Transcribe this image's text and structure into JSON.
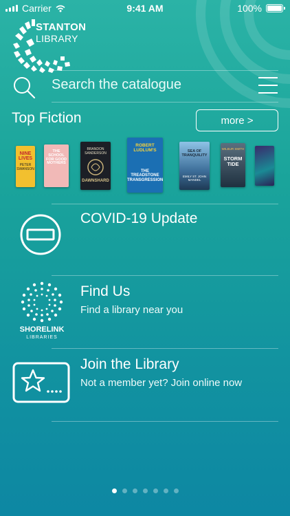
{
  "status_bar": {
    "carrier": "Carrier",
    "time": "9:41 AM",
    "battery": "100%"
  },
  "logo": {
    "line1": "STANTON",
    "line2": "LIBRARY"
  },
  "search": {
    "placeholder": "Search the catalogue"
  },
  "top_fiction": {
    "title": "Top Fiction",
    "more_label": "more >",
    "books": [
      {
        "title": "NINE LIVES",
        "author": "PETER SWANSON"
      },
      {
        "title": "THE SCHOOL FOR GOOD MOTHERS",
        "author": ""
      },
      {
        "title": "DAWNSHARD",
        "author": "BRANDON SANDERSON"
      },
      {
        "title": "THE TREADSTONE TRANSGRESSION",
        "author": "ROBERT LUDLUM'S"
      },
      {
        "title": "SEA OF TRANQUILITY",
        "author": "EMILY ST. JOHN MANDEL"
      },
      {
        "title": "STORM TIDE",
        "author": "WILBUR SMITH"
      },
      {
        "title": "",
        "author": ""
      }
    ]
  },
  "cards": [
    {
      "title": "COVID-19 Update",
      "subtitle": "",
      "icon": "no-entry-icon"
    },
    {
      "title": "Find Us",
      "subtitle": "Find a library near you",
      "icon": "shorelink-libraries-logo",
      "logo_text1": "SHORELINK",
      "logo_text2": "LIBRARIES"
    },
    {
      "title": "Join the Library",
      "subtitle": "Not a member yet? Join online now",
      "icon": "membership-card-icon"
    }
  ],
  "pager": {
    "pages": 7,
    "active": 1
  },
  "colors": {
    "background_top": "#2bb3a6",
    "background_bottom": "#0d87a3",
    "accent": "#ffffff"
  }
}
